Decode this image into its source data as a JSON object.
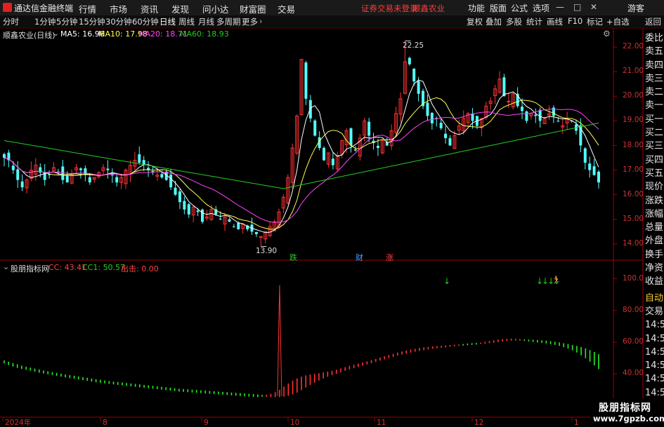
{
  "app": {
    "title": "通达信金融终端",
    "status_login": "证券交易未登录",
    "status_stock": "顺鑫农业",
    "guest": "游客"
  },
  "menu": [
    "行情",
    "市场",
    "资讯",
    "发现",
    "问小达",
    "财富圈",
    "交易"
  ],
  "menu_right": [
    "功能",
    "版面",
    "公式",
    "选项"
  ],
  "periods": [
    "分时",
    "1分钟",
    "5分钟",
    "15分钟",
    "30分钟",
    "60分钟",
    "日线",
    "周线",
    "月线",
    "多周期",
    "更多"
  ],
  "period_active": "日线",
  "toolbar_right": [
    "复权",
    "叠加",
    "多股",
    "统计",
    "画线",
    "F10",
    "标记",
    "+自选",
    "返回"
  ],
  "main_legend": {
    "title": "顺鑫农业(日线)",
    "ma5": "MA5: 16.96",
    "ma10": "MA10: 17.98",
    "ma20": "MA20: 18.71",
    "ma60": "MA60: 18.93"
  },
  "main_yticks": [
    "22.00",
    "21.00",
    "20.00",
    "19.00",
    "18.00",
    "17.00",
    "16.00",
    "15.00",
    "14.00"
  ],
  "main_yvalues": [
    22,
    21,
    20,
    19,
    18,
    17,
    16,
    15,
    14
  ],
  "high_label": "22.25",
  "low_label": "13.90",
  "markers": [
    {
      "text": "跌",
      "color": "#28c828"
    },
    {
      "text": "财",
      "color": "#4aa3ff"
    },
    {
      "text": "涨",
      "color": "#ff4040"
    }
  ],
  "sub_legend": {
    "title": "股朋指标网",
    "cc": "CC: 43.41",
    "cc1": "CC1: 50.57",
    "out": "出击: 0.00"
  },
  "sub_yticks": [
    "100.0",
    "80.00",
    "60.00",
    "40.00",
    "20.00"
  ],
  "sub_yvalues": [
    100,
    80,
    60,
    40,
    20
  ],
  "right_panel": [
    "委比",
    "卖五",
    "卖四",
    "卖三",
    "卖二",
    "卖一",
    "买一",
    "买二",
    "买三",
    "买四",
    "买五",
    "现价",
    "涨跌",
    "涨幅",
    "总量",
    "外盘",
    "换手",
    "净资",
    "收益",
    "自动",
    "交易",
    "14:5",
    "14:5",
    "14:5",
    "14:5",
    "14:5",
    "14:5",
    "14:5",
    "14:5"
  ],
  "x_labels": [
    "2024年",
    "8",
    "9",
    "10",
    "11",
    "12",
    "1"
  ],
  "watermark": {
    "cn": "股朋指标网",
    "url": "www.7gpzb.com"
  },
  "colors": {
    "up": "#ff3232",
    "down": "#54ffff",
    "ma5": "#ffffff",
    "ma10": "#ffff55",
    "ma20": "#ff44ff",
    "ma60": "#22cc22",
    "axis": "#b00000",
    "grid": "#550000"
  },
  "chart_data": [
    {
      "type": "candlestick",
      "title": "顺鑫农业(日线)",
      "series": [
        {
          "name": "MA5",
          "last": 16.96
        },
        {
          "name": "MA10",
          "last": 17.98
        },
        {
          "name": "MA20",
          "last": 18.71
        },
        {
          "name": "MA60",
          "last": 18.93
        }
      ],
      "ylim": [
        13.6,
        22.6
      ],
      "high": 22.25,
      "low": 13.9,
      "closes": [
        17.5,
        17.4,
        17.0,
        16.6,
        16.3,
        16.6,
        17.0,
        17.2,
        16.9,
        16.6,
        16.8,
        17.1,
        16.9,
        16.6,
        16.5,
        16.8,
        17.1,
        17.0,
        16.8,
        16.5,
        16.7,
        16.9,
        17.1,
        17.0,
        16.8,
        16.5,
        16.7,
        17.0,
        17.2,
        17.4,
        17.3,
        17.2,
        17.0,
        16.9,
        16.8,
        16.7,
        16.6,
        16.3,
        16.0,
        15.7,
        15.4,
        15.2,
        15.5,
        15.3,
        14.9,
        15.1,
        15.4,
        15.2,
        15.0,
        15.1,
        14.9,
        14.7,
        14.6,
        14.8,
        14.6,
        14.5,
        14.4,
        14.3,
        14.5,
        14.7,
        14.9,
        15.3,
        15.9,
        16.7,
        17.9,
        19.2,
        21.5,
        19.9,
        19.1,
        18.4,
        17.9,
        17.4,
        17.7,
        17.2,
        17.6,
        18.2,
        18.6,
        18.0,
        17.8,
        18.3,
        19.0,
        18.4,
        18.1,
        17.9,
        18.2,
        18.0,
        18.6,
        19.3,
        19.9,
        21.4,
        21.3,
        20.6,
        20.1,
        19.6,
        19.2,
        18.9,
        19.1,
        18.7,
        18.3,
        18.0,
        18.4,
        18.8,
        19.1,
        19.3,
        19.0,
        18.8,
        19.1,
        19.6,
        19.8,
        20.3,
        20.7,
        20.0,
        19.8,
        20.1,
        19.6,
        19.4,
        19.0,
        19.3,
        19.2,
        19.0,
        19.1,
        19.3,
        19.2,
        19.0,
        18.8,
        19.1,
        19.0,
        18.6,
        18.0,
        17.3,
        17.0,
        16.8,
        16.5
      ]
    },
    {
      "type": "bar",
      "title": "股朋指标网",
      "series": [
        {
          "name": "CC",
          "last": 43.41
        },
        {
          "name": "CC1",
          "last": 50.57
        },
        {
          "name": "出击",
          "last": 0.0
        }
      ],
      "ylim": [
        14,
        106
      ],
      "cc": [
        47,
        46,
        45,
        44.2,
        43.5,
        43,
        42.4,
        41.8,
        41.2,
        40.7,
        40.2,
        39.7,
        39.2,
        38.7,
        38.2,
        37.8,
        37.4,
        36.9,
        36.5,
        36.1,
        35.6,
        35.2,
        34.8,
        34.4,
        34.1,
        33.8,
        33.5,
        33.2,
        32.9,
        32.6,
        32.3,
        32,
        31.7,
        31.4,
        31.1,
        30.8,
        30.5,
        30.2,
        29.9,
        29.6,
        29.3,
        29.1,
        28.9,
        28.7,
        28.5,
        28.3,
        28.1,
        27.9,
        27.7,
        27.5,
        27.3,
        27.1,
        26.9,
        26.7,
        26.5,
        26.3,
        26.1,
        25.9,
        25.8,
        26,
        26.4,
        27,
        28,
        29.5,
        31.5,
        33.5,
        35.3,
        36.7,
        37.8,
        38.6,
        39.2,
        39.6,
        40,
        40.5,
        41,
        41.5,
        42.2,
        43,
        43.8,
        44.6,
        45.3,
        46,
        46.7,
        47.4,
        48.2,
        49,
        49.8,
        50.6,
        51.4,
        52.2,
        53,
        53.7,
        54.3,
        54.9,
        55.4,
        55.9,
        56.3,
        56.6,
        56.9,
        57.1,
        57.3,
        57.5,
        57.7,
        57.9,
        58.1,
        58.3,
        58.5,
        58.7,
        58.9,
        59.3,
        59.8,
        60.3,
        60.8,
        61.2,
        61.5,
        61.7,
        61.8,
        61.7,
        61.5,
        61.2,
        60.9,
        60.6,
        60.3,
        60,
        59.6,
        59.2,
        58.7,
        58.1,
        57.3,
        56.4,
        55.3,
        53.9,
        52.2,
        50.3,
        48.2,
        45.8,
        43.41
      ],
      "cc1": [
        48,
        47.2,
        46.4,
        45.6,
        44.8,
        44.1,
        43.5,
        42.9,
        42.3,
        41.7,
        41.2,
        40.7,
        40.2,
        39.7,
        39.2,
        38.8,
        38.4,
        37.9,
        37.5,
        37.1,
        36.6,
        36.2,
        35.8,
        35.4,
        35,
        34.7,
        34.4,
        34.1,
        33.8,
        33.5,
        33.2,
        32.9,
        32.6,
        32.3,
        32,
        31.7,
        31.4,
        31.1,
        30.8,
        30.5,
        30.2,
        30,
        29.8,
        29.6,
        29.4,
        29.2,
        29,
        28.8,
        28.6,
        28.4,
        28.2,
        28,
        27.8,
        27.6,
        27.4,
        27.2,
        27,
        26.8,
        26.6,
        26.3,
        26,
        25.8,
        25.7,
        25.8,
        26.1,
        26.7,
        27.5,
        28.6,
        30.1,
        31.8,
        33.4,
        34.9,
        36.3,
        37.5,
        38.6,
        39.6,
        40.5,
        41.4,
        42.3,
        43.2,
        44,
        44.8,
        45.6,
        46.4,
        47.2,
        48,
        48.8,
        49.6,
        50.4,
        51.2,
        52,
        52.6,
        53.2,
        53.8,
        54.4,
        54.9,
        55.4,
        55.8,
        56.2,
        56.6,
        56.9,
        57.2,
        57.5,
        57.8,
        58.1,
        58.4,
        58.7,
        58.9,
        59.1,
        59.3,
        59.5,
        59.8,
        60.1,
        60.5,
        60.9,
        61.2,
        61.4,
        61.5,
        61.4,
        61.3,
        61.2,
        61.1,
        60.9,
        60.7,
        60.5,
        60.2,
        59.8,
        59.4,
        58.9,
        58.4,
        57.8,
        57.2,
        56.5,
        55.6,
        54.6,
        53.4,
        52.0,
        50.57
      ],
      "spike": {
        "index": 63,
        "value": 96
      }
    }
  ]
}
